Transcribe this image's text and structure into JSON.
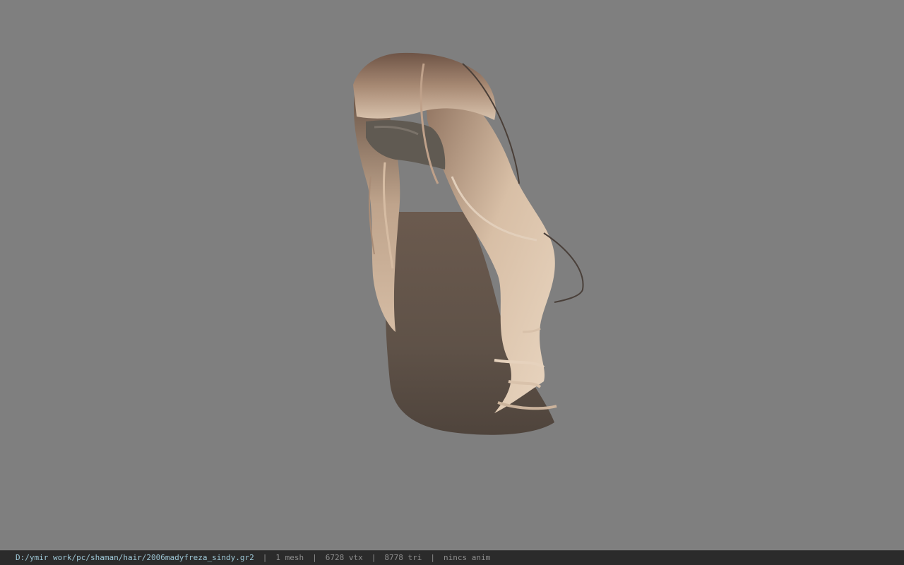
{
  "viewer": {
    "background_color": "#7f7f7f",
    "model_icon": "hair-mesh-model"
  },
  "statusbar": {
    "file_path": "D:/ymir work/pc/shaman/hair/2006madyfreza_sindy.gr2",
    "separator": "|",
    "mesh_count": "1 mesh",
    "vertex_count": "6728 vtx",
    "triangle_count": "8778 tri",
    "anim_status": "nincs anim",
    "path_color": "#9fc9d8",
    "text_color": "#8d8d8d"
  }
}
